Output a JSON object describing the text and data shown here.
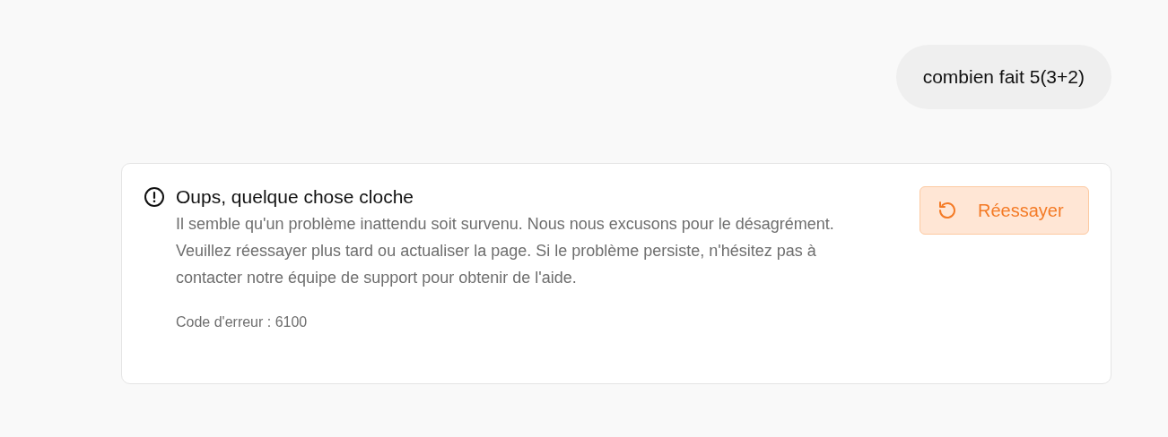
{
  "user_message": {
    "text": "combien fait 5(3+2)"
  },
  "error_card": {
    "title": "Oups, quelque chose cloche",
    "message": "Il semble qu'un problème inattendu soit survenu. Nous nous excusons pour le désagrément. Veuillez réessayer plus tard ou actualiser la page. Si le problème persiste, n'hésitez pas à contacter notre équipe de support pour obtenir de l'aide.",
    "error_code": "Code d'erreur : 6100",
    "retry_button": {
      "label": "Réessayer"
    }
  }
}
